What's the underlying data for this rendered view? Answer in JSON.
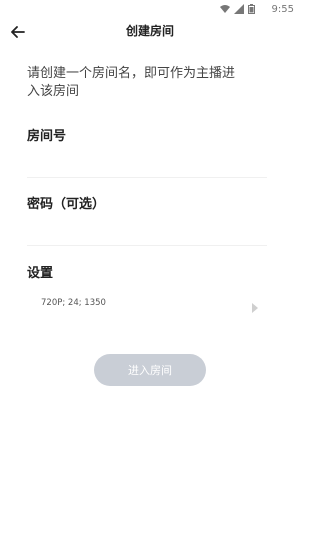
{
  "status_bar": {
    "time": "9:55",
    "icons": [
      "wifi-icon",
      "signal-icon",
      "battery-icon"
    ]
  },
  "header": {
    "back_icon": "arrow-left-icon",
    "title": "创建房间"
  },
  "description": "请创建一个房间名，即可作为主播进入该房间",
  "room_number": {
    "label": "房间号",
    "value": "",
    "placeholder": ""
  },
  "password": {
    "label": "密码（可选）",
    "value": "",
    "placeholder": ""
  },
  "settings": {
    "label": "设置",
    "value": "720P;  24;  1350",
    "chevron_icon": "chevron-right-icon"
  },
  "enter_button": {
    "label": "进入房间",
    "color": "#c9ced6"
  }
}
